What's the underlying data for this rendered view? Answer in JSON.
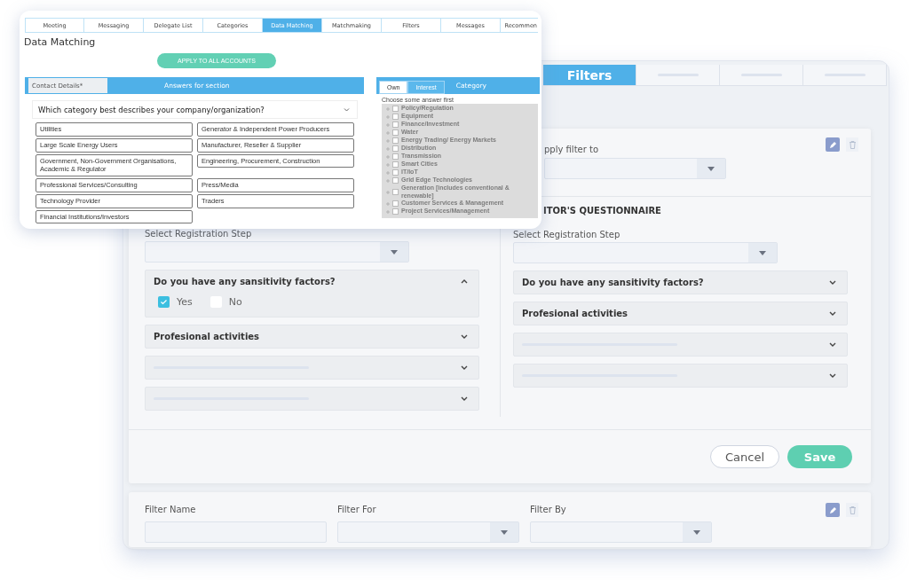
{
  "filters_window": {
    "tabs": [
      {
        "label": "Filters",
        "selected": true
      },
      {
        "selected": false
      },
      {
        "selected": false
      },
      {
        "selected": false
      }
    ],
    "apply_filter_label": "pply filter to",
    "left_column": {
      "step_label": "Select Registration Step",
      "questions": [
        {
          "title": "Do you have any sansitivity factors?",
          "expanded": true,
          "options": [
            {
              "label": "Yes",
              "checked": true
            },
            {
              "label": "No",
              "checked": false
            }
          ]
        },
        {
          "title": "Profesional activities",
          "expanded": false
        },
        {
          "expanded": false
        },
        {
          "expanded": false
        }
      ]
    },
    "right_column": {
      "heading": "ITOR'S QUESTIONNAIRE",
      "step_label": "Select Registration Step",
      "questions": [
        {
          "title": "Do you have any sansitivity factors?",
          "expanded": false
        },
        {
          "title": "Profesional activities",
          "expanded": false
        },
        {
          "expanded": false
        },
        {
          "expanded": false
        }
      ]
    },
    "cancel_button": "Cancel",
    "save_button": "Save",
    "filter_row": [
      {
        "label": "Filter Name",
        "kind": "text"
      },
      {
        "label": "Filter For",
        "kind": "select"
      },
      {
        "label": "Filter By",
        "kind": "select"
      }
    ]
  },
  "data_matching_window": {
    "tabs": [
      {
        "label": "Meeting",
        "selected": false
      },
      {
        "label": "Messaging",
        "selected": false
      },
      {
        "label": "Delegate List",
        "selected": false
      },
      {
        "label": "Categories",
        "selected": false
      },
      {
        "label": "Data Matching",
        "selected": true
      },
      {
        "label": "Matchmaking",
        "selected": false
      },
      {
        "label": "Filters",
        "selected": false
      },
      {
        "label": "Messages",
        "selected": false
      },
      {
        "label": "Recommen",
        "selected": false
      }
    ],
    "title": "Data Matching",
    "apply_button": "APPLY TO ALL ACCOUNTS",
    "section_tab": "Contact Details*",
    "section_header": "Answers for section",
    "question": "Which category best describes your company/organization?",
    "answers": [
      "Utilities",
      "Generator & Independent Power Producers",
      "Large Scale Energy Users",
      "Manufacturer, Reseller & Supplier",
      "Government, Non-Government Organisations, Academic & Regulator",
      "Engineering, Procurement, Construction",
      "Professional Services/Consulting",
      "Press/Media",
      "Technology Provider",
      "Traders",
      "Financial Institutions/Investors"
    ],
    "category_panel": {
      "tabs": [
        {
          "label": "Own",
          "selected": true
        },
        {
          "label": "Interest",
          "selected": false
        }
      ],
      "title": "Category",
      "hint": "Choose some answer first",
      "items": [
        {
          "label": "Policy/Regulation",
          "checked": false
        },
        {
          "label": "Equipment",
          "checked": false
        },
        {
          "label": "Finance/Investment",
          "checked": false
        },
        {
          "label": "Water",
          "checked": false
        },
        {
          "label": "Energy Trading/ Energy Markets",
          "checked": false
        },
        {
          "label": "Distribution",
          "checked": false
        },
        {
          "label": "Transmission",
          "checked": false
        },
        {
          "label": "Smart Cities",
          "checked": false
        },
        {
          "label": "IT/IoT",
          "checked": false
        },
        {
          "label": "Grid Edge Technologies",
          "checked": false
        },
        {
          "label": "Generation [includes conventional & renewable]",
          "checked": false
        },
        {
          "label": "Customer Services & Management",
          "checked": false
        },
        {
          "label": "Project Services/Management",
          "checked": false
        }
      ]
    }
  }
}
